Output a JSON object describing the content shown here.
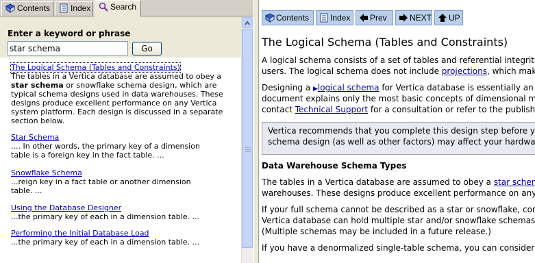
{
  "tabs": [
    {
      "label": "Contents",
      "icon": "book-icon"
    },
    {
      "label": "Index",
      "icon": "index-icon"
    },
    {
      "label": "Search",
      "icon": "search-icon"
    }
  ],
  "search": {
    "heading": "Enter a keyword or phrase",
    "value": "star schema",
    "go_label": "Go"
  },
  "results": [
    {
      "title": "The Logical Schema (Tables and Constraints)",
      "lines": [
        "The tables in a Vertica database are assumed to obey a",
        "star schema or snowflake schema design, which are",
        "typical schema designs used in data warehouses. These",
        "designs produce excellent performance on any Vertica",
        "system platform. Each design is discussed in a separate",
        "section below."
      ]
    },
    {
      "title": "Star Schema",
      "lines": [
        ".... In other words, the primary key of a dimension",
        "table is a foreign key in the fact table. ..."
      ]
    },
    {
      "title": "Snowflake Schema",
      "lines": [
        "...reign key in a fact table or another dimension",
        "table. ..."
      ]
    },
    {
      "title": "Using the Database Designer",
      "lines": [
        "...the primary key of each in a dimension table. ..."
      ]
    },
    {
      "title": "Performing the Initial Database Load",
      "lines": [
        "...the primary key of each in a dimension table. ..."
      ]
    }
  ],
  "nav": {
    "contents": "Contents",
    "index": "Index",
    "prev": "Prev",
    "next": "NEXT",
    "up": "UP"
  },
  "doc": {
    "title": "The Logical Schema (Tables and Constraints)",
    "p1_a": "A logical schema consists of a set of tables and referential integrity c",
    "p1_b_pre": "users. The logical schema does not include ",
    "p1_b_link": "projections",
    "p1_b_post": ", which make",
    "p2_a_pre": "Designing a ",
    "p2_a_link": "logical schema",
    "p2_a_post": " for Vertica database is essentially an e",
    "p2_b": "document explains only the most basic concepts of dimensional mod",
    "p2_c_pre": "contact ",
    "p2_c_link": "Technical Support",
    "p2_c_post": " for a consultation or refer to the published",
    "note_a": "Vertica recommends that you complete this design step before you",
    "note_b": "schema design (as well as other factors) may affect your hardware",
    "h2": "Data Warehouse Schema Types",
    "p3_a_pre": "The tables in a Vertica database are assumed to obey a ",
    "p3_a_link": "star schem",
    "p3_b": "warehouses. These designs produce excellent performance on any V",
    "p4_a": "If your full schema cannot be described as a star or snowflake, cons",
    "p4_b": "Vertica database can hold multiple star and/or snowflake schemas th",
    "p4_c": "(Multiple schemas may be included in a future release.)",
    "p5_a": "If you have a denormalized single-table schema, you can consider it"
  }
}
